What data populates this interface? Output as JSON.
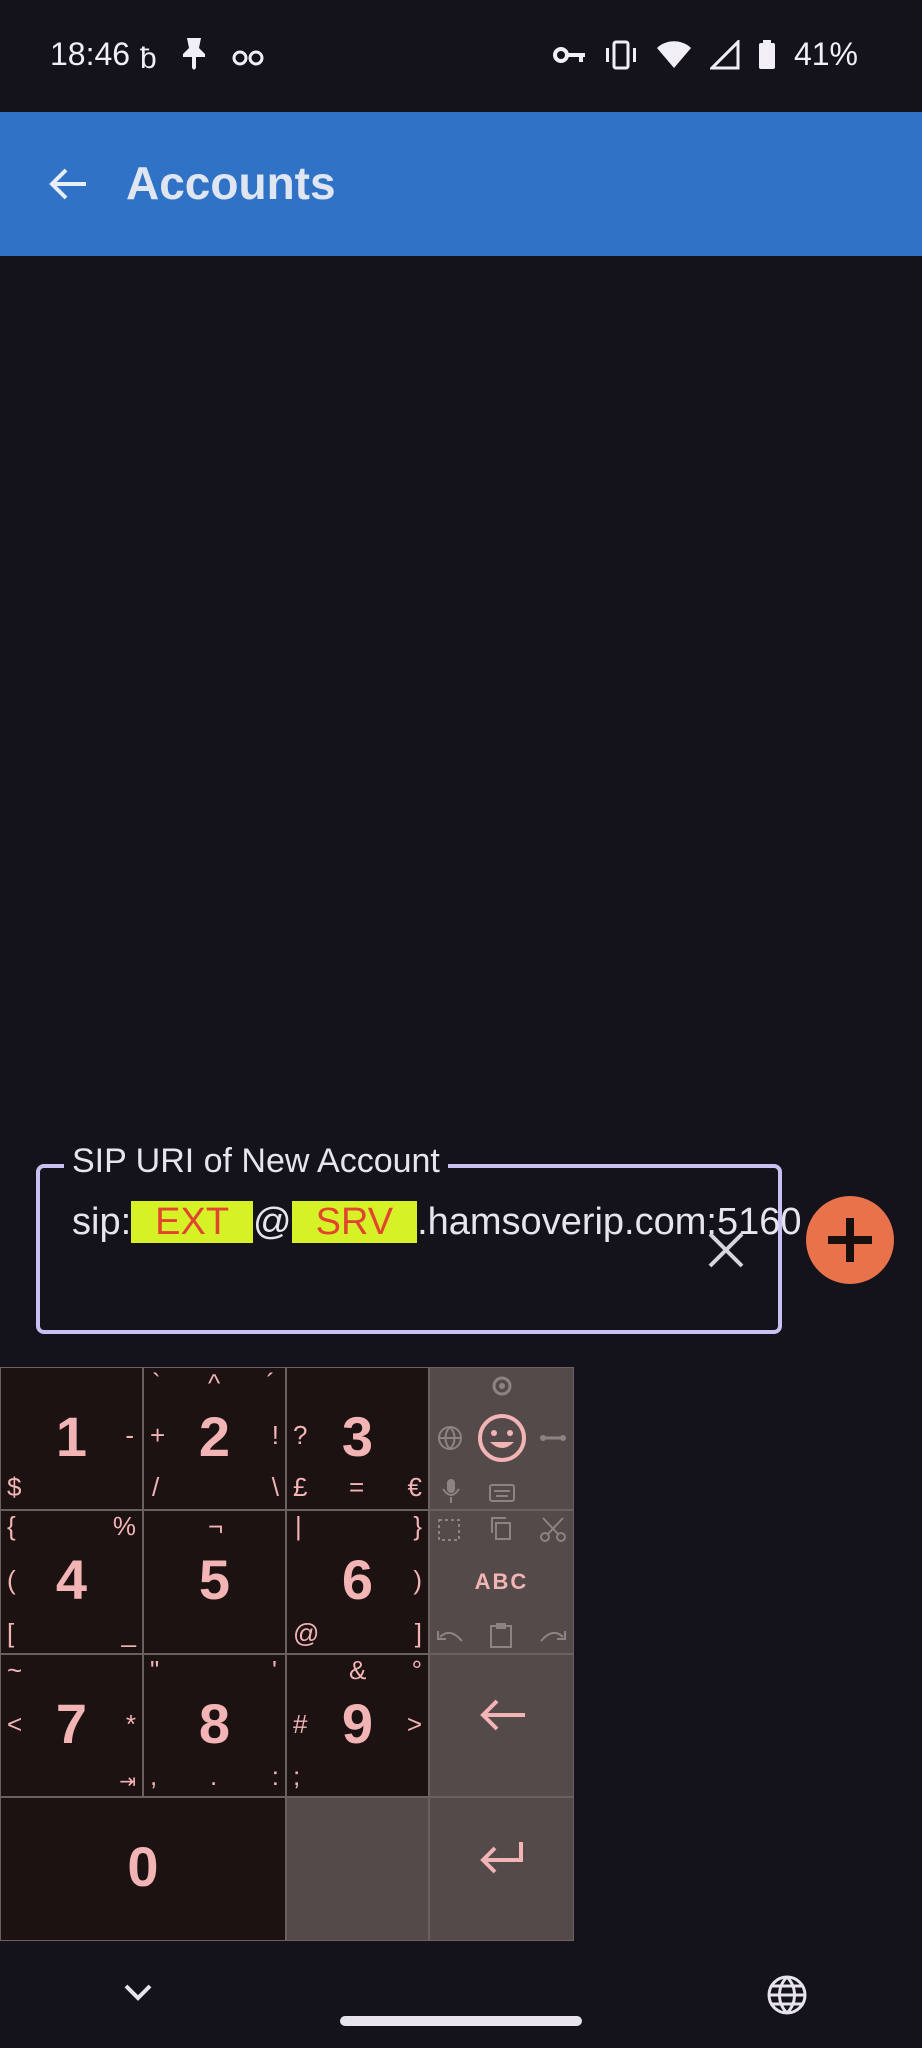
{
  "status_bar": {
    "time": "18:46",
    "left_icons": [
      "b-icon",
      "pin-icon",
      "infinity-icon"
    ],
    "right_icons": [
      "key-icon",
      "vibrate-icon",
      "wifi-icon",
      "signal-icon",
      "battery-icon"
    ],
    "battery": "41%"
  },
  "app_bar": {
    "title": "Accounts",
    "background_color": "#3073c6"
  },
  "new_account": {
    "label": "SIP URI of New Account",
    "value_prefix": "sip:",
    "value_ext": "EXT",
    "value_at": "@",
    "value_srv": "SRV",
    "value_suffix": ".hamsoverip.com:5160",
    "clear_icon": "close-icon",
    "add_icon": "plus-icon",
    "accent_color": "#e8734b"
  },
  "keyboard": {
    "keys": {
      "k1": "1",
      "k2": "2",
      "k3": "3",
      "k4": "4",
      "k5": "5",
      "k6": "6",
      "k7": "7",
      "k8": "8",
      "k9": "9",
      "k0": "0",
      "abc": "ABC"
    },
    "symbols": {
      "k1_dash": "-",
      "k1_dollar": "$",
      "k2_grave": "`",
      "k2_caret": "^",
      "k2_acute": "´",
      "k2_plus": "+",
      "k2_excl": "!",
      "k2_slash": "/",
      "k2_bslash": "\\",
      "k3_q": "?",
      "k3_pound": "£",
      "k3_eq": "=",
      "k3_euro": "€",
      "k4_lbrace": "{",
      "k4_pct": "%",
      "k4_lparen": "(",
      "k4_lbracket": "[",
      "k4_underscore": "_",
      "k5_not": "¬",
      "k6_pipe": "|",
      "k6_rbrace": "}",
      "k6_rparen": ")",
      "k6_at": "@",
      "k6_rbracket": "]",
      "k7_tilde": "~",
      "k7_lt": "<",
      "k7_star": "*",
      "k7_tab": "⇥",
      "k8_quote": "\"",
      "k8_apos": "'",
      "k8_comma": ",",
      "k8_dot": ".",
      "k8_colon": ":",
      "k9_amp": "&",
      "k9_deg": "°",
      "k9_hash": "#",
      "k9_gt": ">",
      "k9_semi": ";"
    }
  }
}
